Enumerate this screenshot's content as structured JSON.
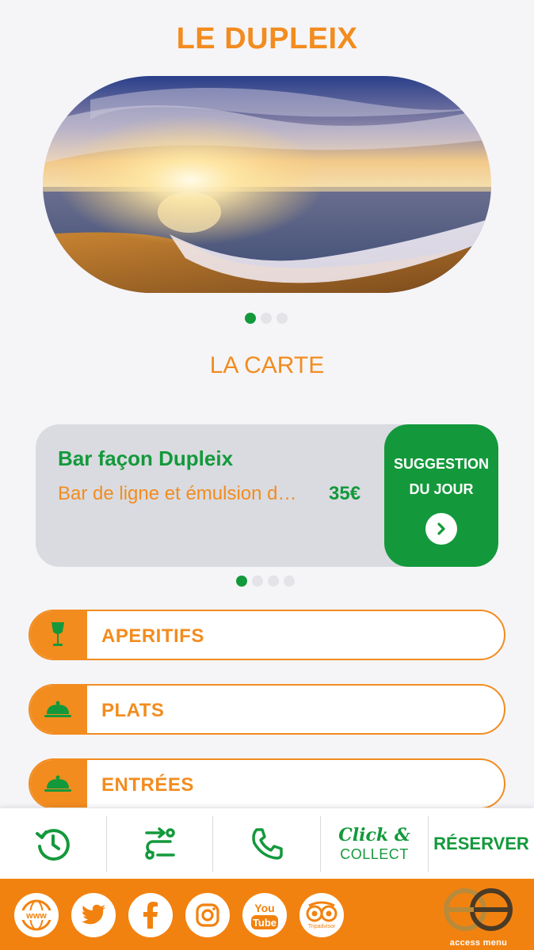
{
  "header": {
    "title": "LE DUPLEIX"
  },
  "carousel": {
    "image": "beach-sunset",
    "slides": 3,
    "active_slide": 1
  },
  "menu_section": {
    "title": "LA CARTE"
  },
  "suggestion": {
    "name": "Bar façon Dupleix",
    "description": "Bar de ligne et émulsion d…",
    "price": "35€",
    "badge_line1": "SUGGESTION",
    "badge_line2": "DU JOUR",
    "slides": 4,
    "active_slide": 1
  },
  "categories": [
    {
      "label": "APERITIFS",
      "icon": "wine-glass-icon"
    },
    {
      "label": "PLATS",
      "icon": "cloche-icon"
    },
    {
      "label": "ENTRÉES",
      "icon": "cloche-icon"
    }
  ],
  "actions": {
    "hours_icon": "clock-history-icon",
    "directions_icon": "route-icon",
    "call_icon": "phone-icon",
    "click_line1": "Click &",
    "click_line2": "COLLECT",
    "reserve": "RÉSERVER"
  },
  "footer": {
    "socials": [
      "www",
      "twitter",
      "facebook",
      "instagram",
      "youtube",
      "tripadvisor"
    ],
    "www_label": "www",
    "youtube_you": "You",
    "youtube_tube": "Tube",
    "tripadvisor_label": "Tripadvisor",
    "brand": "access menu"
  },
  "colors": {
    "orange": "#f28c1f",
    "green": "#13993b",
    "footer": "#f2820f"
  }
}
